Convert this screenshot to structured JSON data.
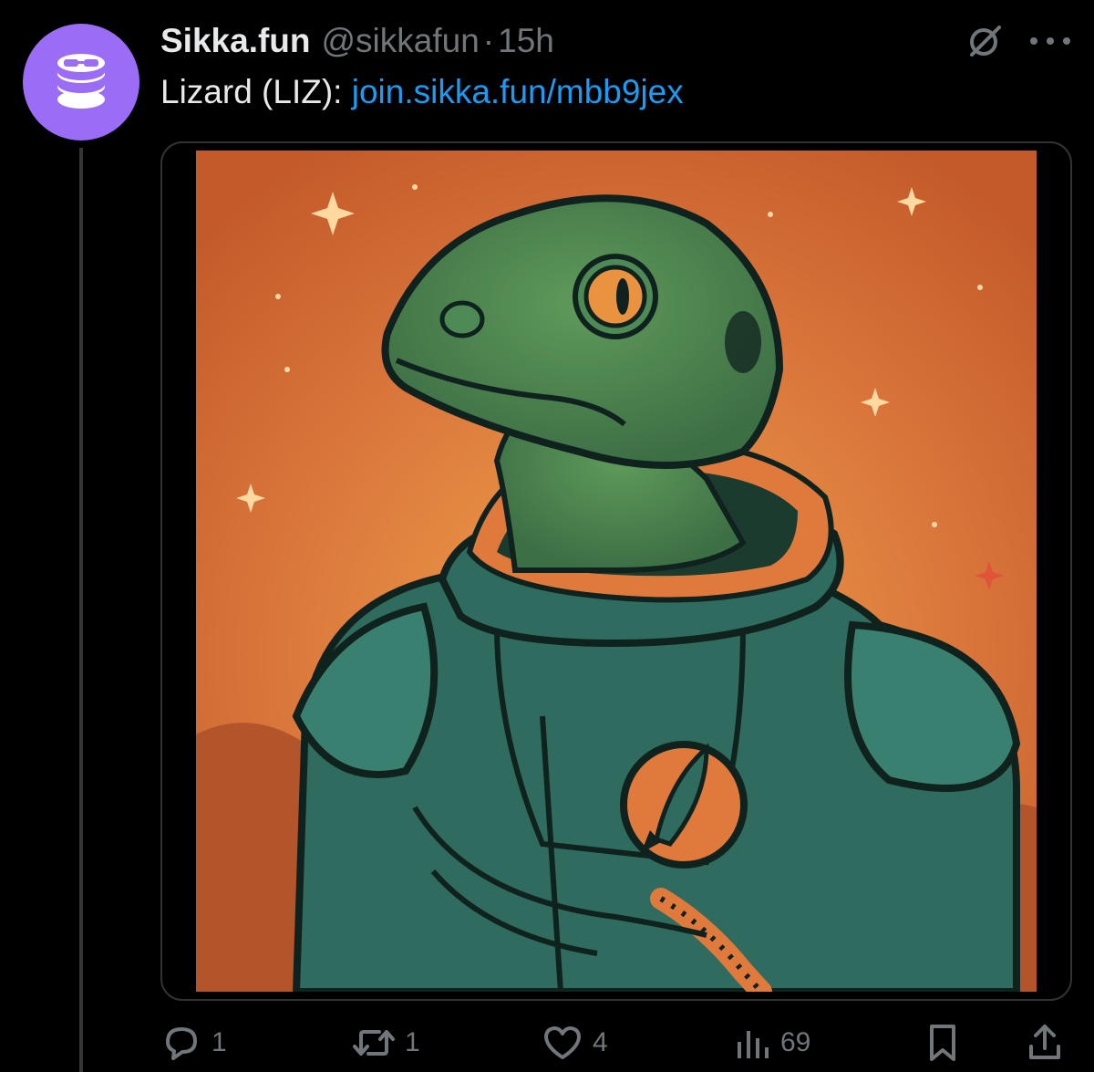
{
  "tweet": {
    "display_name": "Sikka.fun",
    "handle": "@sikkafun",
    "separator": "·",
    "time": "15h",
    "text_prefix": "Lizard (LIZ): ",
    "link": "join.sikka.fun/mbb9jex"
  },
  "actions": {
    "replies": "1",
    "reposts": "1",
    "likes": "4",
    "views": "69"
  },
  "colors": {
    "background": "#000000",
    "accent_link": "#1d9bf0",
    "avatar_bg": "#9b6cf5",
    "muted": "#71767b"
  },
  "icons": [
    "coin-stack-avatar-icon",
    "grok-icon",
    "more-icon",
    "reply-icon",
    "repost-icon",
    "like-icon",
    "views-icon",
    "bookmark-icon",
    "share-icon"
  ]
}
